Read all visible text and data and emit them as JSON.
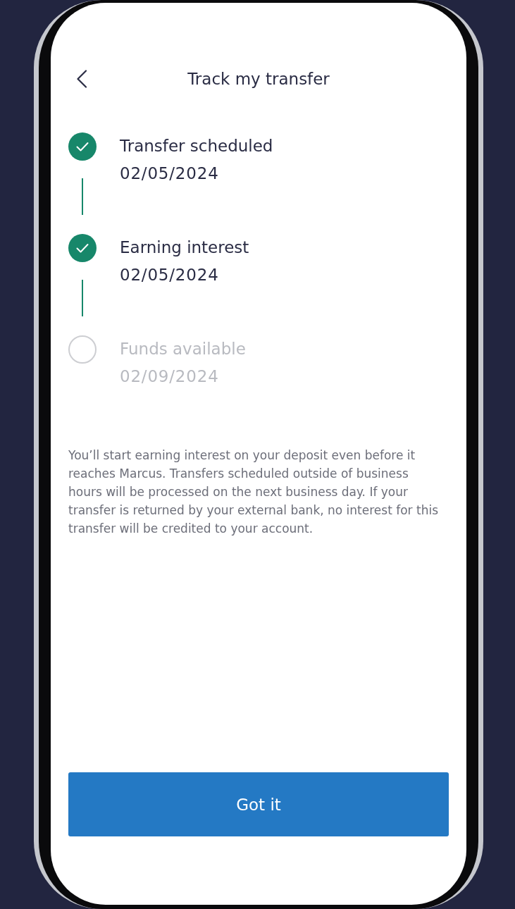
{
  "header": {
    "title": "Track my transfer"
  },
  "steps": [
    {
      "label": "Transfer scheduled",
      "date": "02/05/2024",
      "completed": true
    },
    {
      "label": "Earning interest",
      "date": "02/05/2024",
      "completed": true
    },
    {
      "label": "Funds available",
      "date": "02/09/2024",
      "completed": false
    }
  ],
  "note": "You’ll start earning interest on your deposit even before it reaches Marcus. Transfers scheduled outside of business hours will be processed on the next business day. If your transfer is returned by your external bank, no interest for this transfer will be credited to your account.",
  "button": {
    "label": "Got it"
  }
}
